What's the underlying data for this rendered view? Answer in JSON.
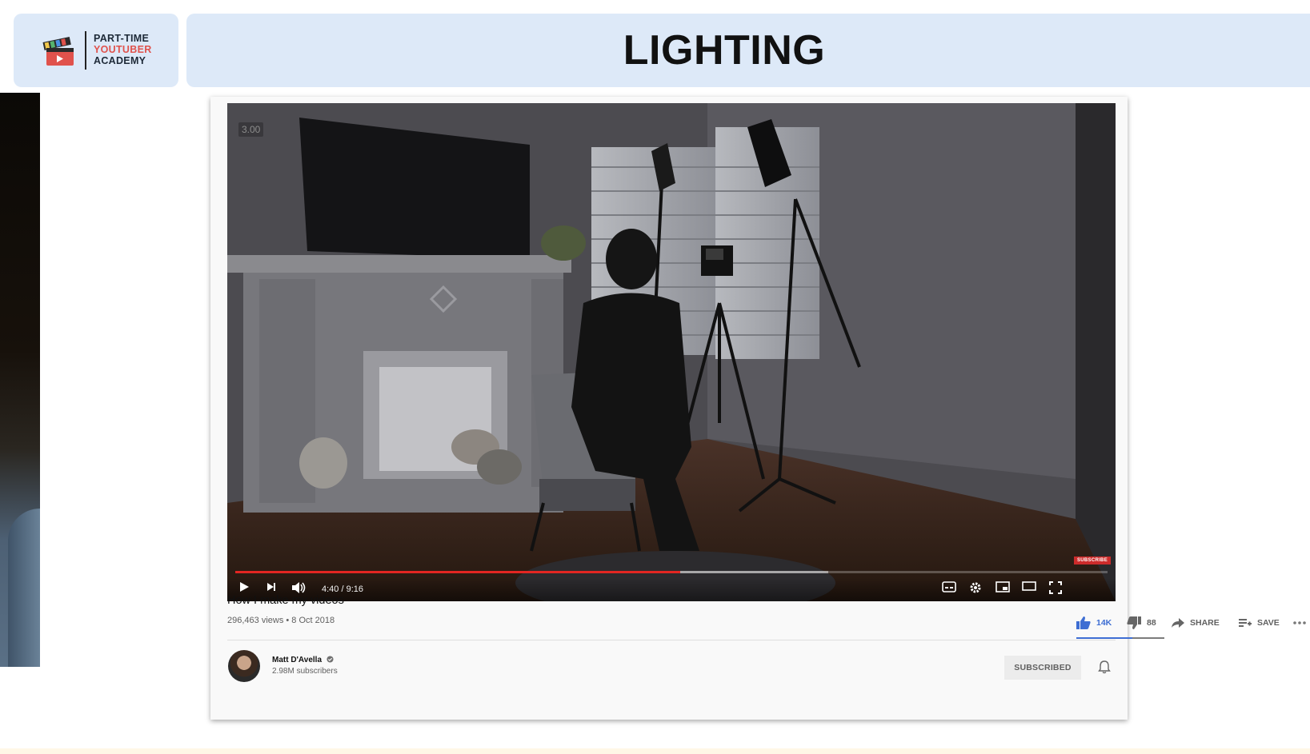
{
  "logo": {
    "line1": "PART-TIME",
    "line2": "YOUTUBER",
    "line3": "ACADEMY",
    "icon": "clapperboard-icon"
  },
  "slide_title": "LIGHTING",
  "player": {
    "speed_label": "3.00",
    "subscribe_badge": "SUBSCRIBE",
    "time_display": "4:40 / 9:16",
    "progress_percent": 51,
    "buffered_percent": 68,
    "progress_color": "#e32622",
    "controls_left": [
      "play-icon",
      "next-icon",
      "volume-icon"
    ],
    "controls_right": [
      "captions-icon",
      "settings-icon",
      "miniplayer-icon",
      "theater-mode-icon",
      "fullscreen-icon"
    ]
  },
  "video": {
    "title": "How I make my videos",
    "meta": "296,463 views • 8 Oct 2018",
    "likes": "14K",
    "dislikes": "88",
    "share_label": "SHARE",
    "save_label": "SAVE",
    "like_color": "#3e6ed3"
  },
  "channel": {
    "name": "Matt D'Avella",
    "verified_icon": "verified-check-icon",
    "subscribers": "2.98M subscribers",
    "subscribed_label": "SUBSCRIBED"
  }
}
